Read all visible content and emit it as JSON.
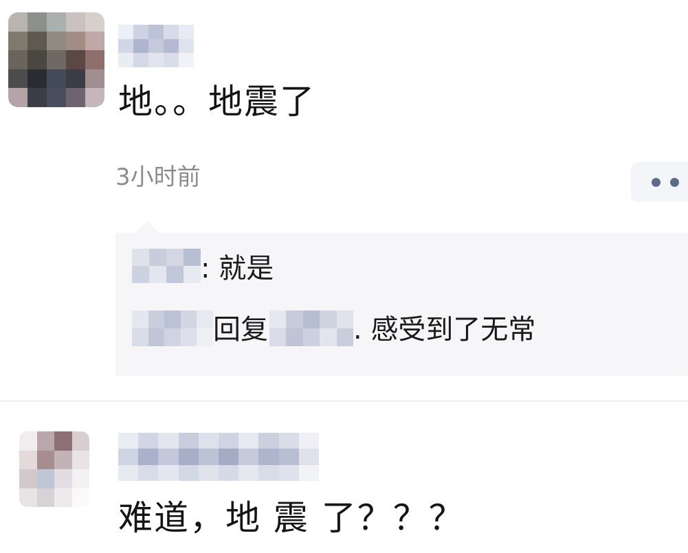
{
  "comments": [
    {
      "avatar_icon": "user-avatar-pixelated",
      "username_blurred": true,
      "text": "地。。地震了",
      "timestamp": "3小时前",
      "more_icon": "more-dots-icon",
      "replies": [
        {
          "separator": ":",
          "text": "就是"
        },
        {
          "action": "回复",
          "separator": ".",
          "text": "感受到了无常"
        }
      ]
    },
    {
      "avatar_icon": "user-avatar-pixelated",
      "username_blurred": true,
      "text": "难道，地 震 了？？？"
    }
  ],
  "colors": {
    "background": "#ffffff",
    "reply_background": "#f6f6f8",
    "timestamp": "#8c8c8c",
    "more_dots": "#5e6a8a",
    "divider": "#ececec"
  }
}
